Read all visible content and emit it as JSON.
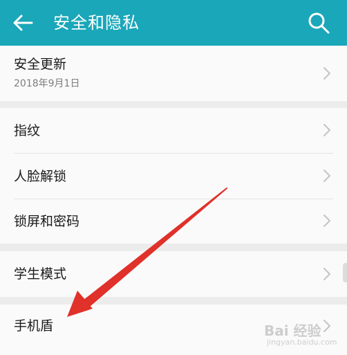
{
  "header": {
    "title": "安全和隐私",
    "background": "#1aa7b9"
  },
  "sections": [
    {
      "items": [
        {
          "label": "安全更新",
          "subtitle": "2018年9月1日"
        }
      ]
    },
    {
      "items": [
        {
          "label": "指纹"
        },
        {
          "label": "人脸解锁"
        },
        {
          "label": "锁屏和密码"
        }
      ]
    },
    {
      "items": [
        {
          "label": "学生模式"
        }
      ]
    },
    {
      "items": [
        {
          "label": "手机盾"
        }
      ]
    }
  ],
  "annotation": {
    "arrow_color": "#e0312a",
    "watermark_text": "Bai 经验",
    "watermark_url": "jingyan.baidu.com"
  }
}
